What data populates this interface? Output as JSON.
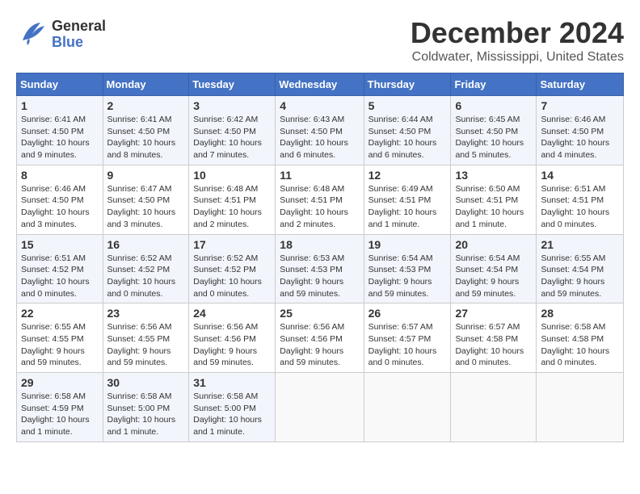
{
  "header": {
    "logo_general": "General",
    "logo_blue": "Blue",
    "title": "December 2024",
    "subtitle": "Coldwater, Mississippi, United States"
  },
  "columns": [
    "Sunday",
    "Monday",
    "Tuesday",
    "Wednesday",
    "Thursday",
    "Friday",
    "Saturday"
  ],
  "weeks": [
    [
      {
        "day": "1",
        "sunrise": "Sunrise: 6:41 AM",
        "sunset": "Sunset: 4:50 PM",
        "daylight": "Daylight: 10 hours and 9 minutes."
      },
      {
        "day": "2",
        "sunrise": "Sunrise: 6:41 AM",
        "sunset": "Sunset: 4:50 PM",
        "daylight": "Daylight: 10 hours and 8 minutes."
      },
      {
        "day": "3",
        "sunrise": "Sunrise: 6:42 AM",
        "sunset": "Sunset: 4:50 PM",
        "daylight": "Daylight: 10 hours and 7 minutes."
      },
      {
        "day": "4",
        "sunrise": "Sunrise: 6:43 AM",
        "sunset": "Sunset: 4:50 PM",
        "daylight": "Daylight: 10 hours and 6 minutes."
      },
      {
        "day": "5",
        "sunrise": "Sunrise: 6:44 AM",
        "sunset": "Sunset: 4:50 PM",
        "daylight": "Daylight: 10 hours and 6 minutes."
      },
      {
        "day": "6",
        "sunrise": "Sunrise: 6:45 AM",
        "sunset": "Sunset: 4:50 PM",
        "daylight": "Daylight: 10 hours and 5 minutes."
      },
      {
        "day": "7",
        "sunrise": "Sunrise: 6:46 AM",
        "sunset": "Sunset: 4:50 PM",
        "daylight": "Daylight: 10 hours and 4 minutes."
      }
    ],
    [
      {
        "day": "8",
        "sunrise": "Sunrise: 6:46 AM",
        "sunset": "Sunset: 4:50 PM",
        "daylight": "Daylight: 10 hours and 3 minutes."
      },
      {
        "day": "9",
        "sunrise": "Sunrise: 6:47 AM",
        "sunset": "Sunset: 4:50 PM",
        "daylight": "Daylight: 10 hours and 3 minutes."
      },
      {
        "day": "10",
        "sunrise": "Sunrise: 6:48 AM",
        "sunset": "Sunset: 4:51 PM",
        "daylight": "Daylight: 10 hours and 2 minutes."
      },
      {
        "day": "11",
        "sunrise": "Sunrise: 6:48 AM",
        "sunset": "Sunset: 4:51 PM",
        "daylight": "Daylight: 10 hours and 2 minutes."
      },
      {
        "day": "12",
        "sunrise": "Sunrise: 6:49 AM",
        "sunset": "Sunset: 4:51 PM",
        "daylight": "Daylight: 10 hours and 1 minute."
      },
      {
        "day": "13",
        "sunrise": "Sunrise: 6:50 AM",
        "sunset": "Sunset: 4:51 PM",
        "daylight": "Daylight: 10 hours and 1 minute."
      },
      {
        "day": "14",
        "sunrise": "Sunrise: 6:51 AM",
        "sunset": "Sunset: 4:51 PM",
        "daylight": "Daylight: 10 hours and 0 minutes."
      }
    ],
    [
      {
        "day": "15",
        "sunrise": "Sunrise: 6:51 AM",
        "sunset": "Sunset: 4:52 PM",
        "daylight": "Daylight: 10 hours and 0 minutes."
      },
      {
        "day": "16",
        "sunrise": "Sunrise: 6:52 AM",
        "sunset": "Sunset: 4:52 PM",
        "daylight": "Daylight: 10 hours and 0 minutes."
      },
      {
        "day": "17",
        "sunrise": "Sunrise: 6:52 AM",
        "sunset": "Sunset: 4:52 PM",
        "daylight": "Daylight: 10 hours and 0 minutes."
      },
      {
        "day": "18",
        "sunrise": "Sunrise: 6:53 AM",
        "sunset": "Sunset: 4:53 PM",
        "daylight": "Daylight: 9 hours and 59 minutes."
      },
      {
        "day": "19",
        "sunrise": "Sunrise: 6:54 AM",
        "sunset": "Sunset: 4:53 PM",
        "daylight": "Daylight: 9 hours and 59 minutes."
      },
      {
        "day": "20",
        "sunrise": "Sunrise: 6:54 AM",
        "sunset": "Sunset: 4:54 PM",
        "daylight": "Daylight: 9 hours and 59 minutes."
      },
      {
        "day": "21",
        "sunrise": "Sunrise: 6:55 AM",
        "sunset": "Sunset: 4:54 PM",
        "daylight": "Daylight: 9 hours and 59 minutes."
      }
    ],
    [
      {
        "day": "22",
        "sunrise": "Sunrise: 6:55 AM",
        "sunset": "Sunset: 4:55 PM",
        "daylight": "Daylight: 9 hours and 59 minutes."
      },
      {
        "day": "23",
        "sunrise": "Sunrise: 6:56 AM",
        "sunset": "Sunset: 4:55 PM",
        "daylight": "Daylight: 9 hours and 59 minutes."
      },
      {
        "day": "24",
        "sunrise": "Sunrise: 6:56 AM",
        "sunset": "Sunset: 4:56 PM",
        "daylight": "Daylight: 9 hours and 59 minutes."
      },
      {
        "day": "25",
        "sunrise": "Sunrise: 6:56 AM",
        "sunset": "Sunset: 4:56 PM",
        "daylight": "Daylight: 9 hours and 59 minutes."
      },
      {
        "day": "26",
        "sunrise": "Sunrise: 6:57 AM",
        "sunset": "Sunset: 4:57 PM",
        "daylight": "Daylight: 10 hours and 0 minutes."
      },
      {
        "day": "27",
        "sunrise": "Sunrise: 6:57 AM",
        "sunset": "Sunset: 4:58 PM",
        "daylight": "Daylight: 10 hours and 0 minutes."
      },
      {
        "day": "28",
        "sunrise": "Sunrise: 6:58 AM",
        "sunset": "Sunset: 4:58 PM",
        "daylight": "Daylight: 10 hours and 0 minutes."
      }
    ],
    [
      {
        "day": "29",
        "sunrise": "Sunrise: 6:58 AM",
        "sunset": "Sunset: 4:59 PM",
        "daylight": "Daylight: 10 hours and 1 minute."
      },
      {
        "day": "30",
        "sunrise": "Sunrise: 6:58 AM",
        "sunset": "Sunset: 5:00 PM",
        "daylight": "Daylight: 10 hours and 1 minute."
      },
      {
        "day": "31",
        "sunrise": "Sunrise: 6:58 AM",
        "sunset": "Sunset: 5:00 PM",
        "daylight": "Daylight: 10 hours and 1 minute."
      },
      {
        "day": "",
        "sunrise": "",
        "sunset": "",
        "daylight": ""
      },
      {
        "day": "",
        "sunrise": "",
        "sunset": "",
        "daylight": ""
      },
      {
        "day": "",
        "sunrise": "",
        "sunset": "",
        "daylight": ""
      },
      {
        "day": "",
        "sunrise": "",
        "sunset": "",
        "daylight": ""
      }
    ]
  ]
}
